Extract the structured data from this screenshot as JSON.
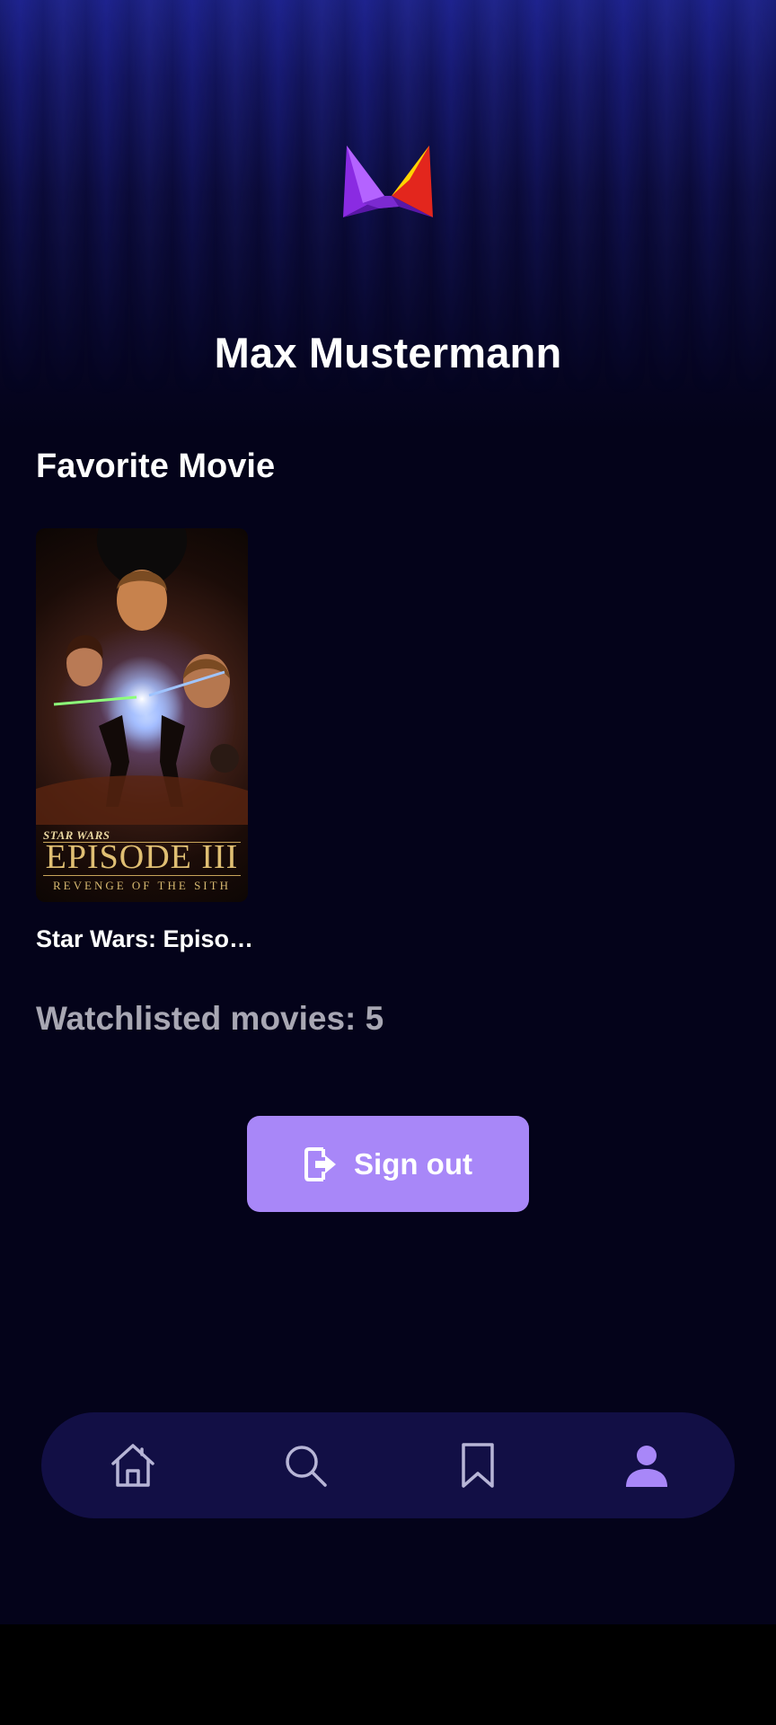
{
  "profile": {
    "user_name": "Max Mustermann",
    "favorite_section_title": "Favorite Movie",
    "favorite_movie": {
      "title": "Star Wars: Episo…",
      "poster": {
        "brand": "STAR WARS",
        "episode": "EPISODE III",
        "subtitle": "REVENGE OF THE SITH"
      }
    },
    "watchlist_text": "Watchlisted movies: 5",
    "signout_label": "Sign out"
  },
  "nav": {
    "items": [
      {
        "icon": "home-icon",
        "active": false
      },
      {
        "icon": "search-icon",
        "active": false
      },
      {
        "icon": "bookmark-icon",
        "active": false
      },
      {
        "icon": "profile-icon",
        "active": true
      }
    ]
  },
  "colors": {
    "background": "#04031a",
    "accent": "#a887f8",
    "nav_background": "#120f45",
    "nav_icon": "#b7b5d6",
    "nav_icon_active": "#a887f8",
    "muted_text": "#a8a7b3"
  }
}
